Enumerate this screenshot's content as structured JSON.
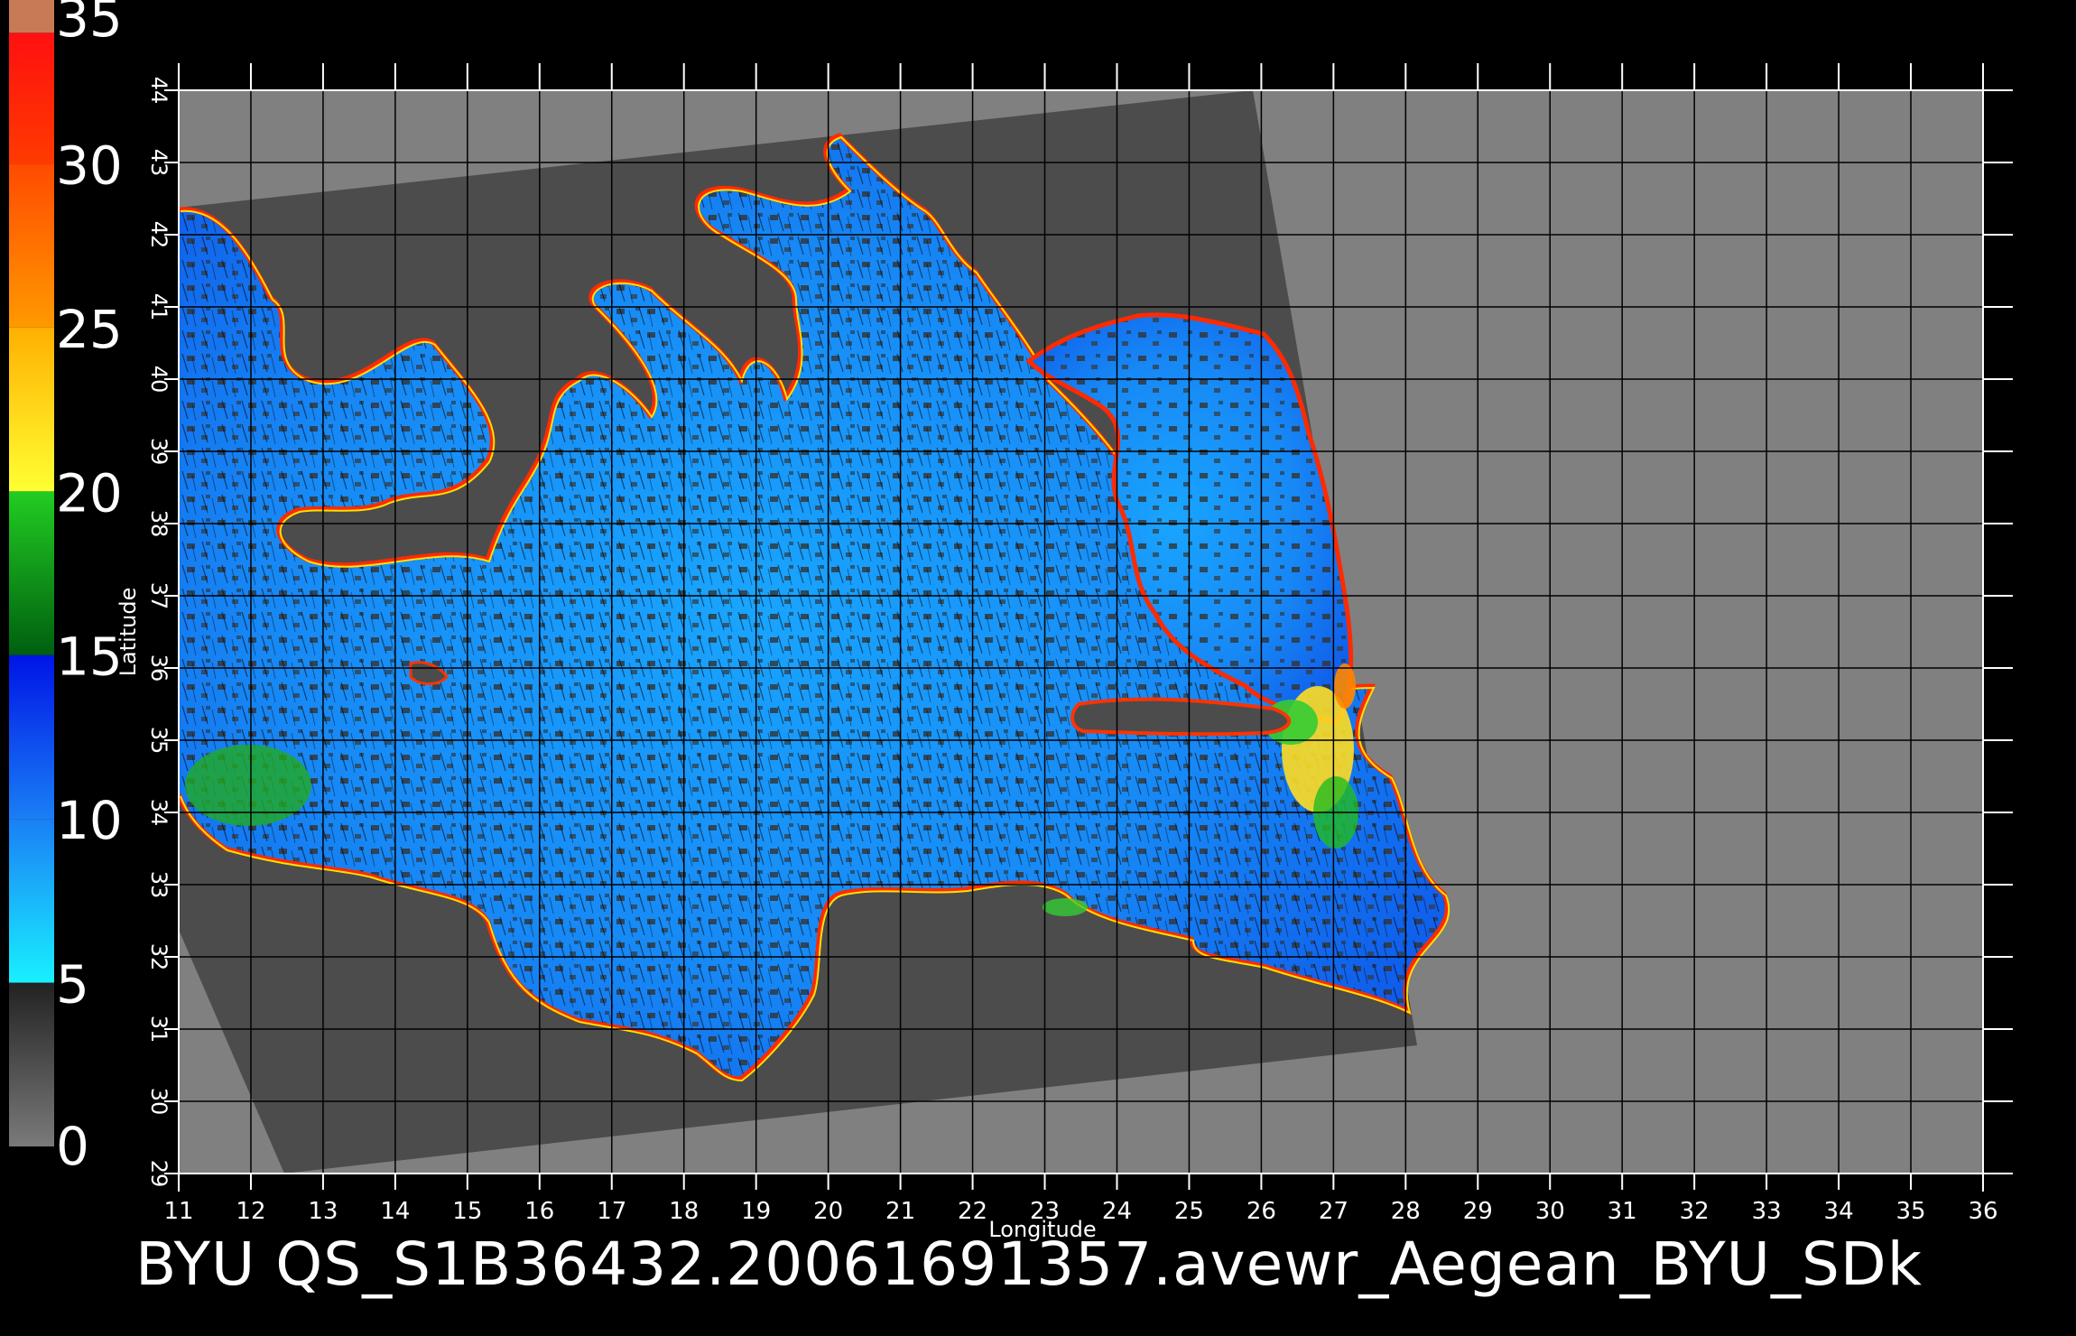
{
  "caption": "BYU  QS_S1B36432.20061691357.avewr_Aegean_BYU_SDk",
  "map": {
    "xlabel": "Longitude",
    "ylabel": "Latitude",
    "lon_ticks": [
      "11",
      "12",
      "13",
      "14",
      "15",
      "16",
      "17",
      "18",
      "19",
      "20",
      "21",
      "22",
      "23",
      "24",
      "25",
      "26",
      "27",
      "28",
      "29",
      "30",
      "31",
      "32",
      "33",
      "34",
      "35",
      "36"
    ],
    "lat_ticks": [
      "29",
      "30",
      "31",
      "32",
      "33",
      "34",
      "35",
      "36",
      "37",
      "38",
      "39",
      "40",
      "41",
      "42",
      "43",
      "44"
    ],
    "lon_range": [
      11,
      36
    ],
    "lat_range": [
      29,
      44
    ]
  },
  "colorbar": {
    "ticks": [
      "0",
      "5",
      "10",
      "15",
      "20",
      "25",
      "30",
      "35"
    ],
    "segments": [
      {
        "from": 0,
        "to": 5,
        "colors": [
          "#7a7a7a",
          "#222222"
        ]
      },
      {
        "from": 5,
        "to": 10,
        "colors": [
          "#19f0ff",
          "#1a7ff5"
        ]
      },
      {
        "from": 10,
        "to": 15,
        "colors": [
          "#1a7ff5",
          "#0014e6"
        ]
      },
      {
        "from": 15,
        "to": 20,
        "colors": [
          "#005f10",
          "#22cc22"
        ]
      },
      {
        "from": 20,
        "to": 25,
        "colors": [
          "#ffff33",
          "#ffb000"
        ]
      },
      {
        "from": 25,
        "to": 30,
        "colors": [
          "#ff9a00",
          "#ff4a00"
        ]
      },
      {
        "from": 30,
        "to": 34,
        "colors": [
          "#ff3a00",
          "#ff1010"
        ]
      },
      {
        "from": 34,
        "to": 35,
        "colors": [
          "#c87a55",
          "#c87a55"
        ]
      }
    ]
  },
  "colors": {
    "background": "#000000",
    "missing": "#808080",
    "land": "#4c4c4c",
    "grid": "#000000"
  }
}
